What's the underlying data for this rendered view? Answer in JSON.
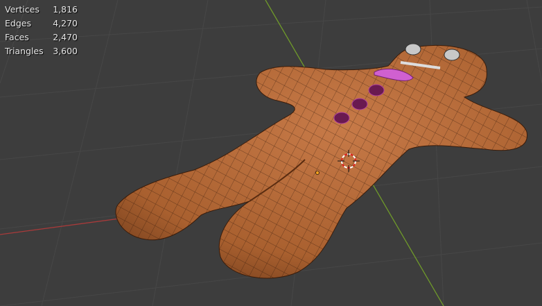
{
  "stats": [
    {
      "label": "Vertices",
      "value": "1,816"
    },
    {
      "label": "Edges",
      "value": "4,270"
    },
    {
      "label": "Faces",
      "value": "2,470"
    },
    {
      "label": "Triangles",
      "value": "3,600"
    }
  ],
  "colors": {
    "background": "#3d3d3d",
    "x_axis": "#a83a3a",
    "y_axis": "#6f9a2a",
    "mesh": "#b8663a",
    "selected": "#d060d0"
  }
}
